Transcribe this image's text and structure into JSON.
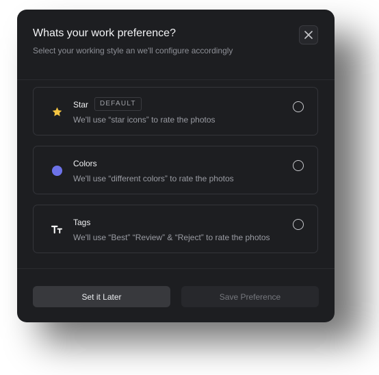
{
  "dialog": {
    "title": "Whats your work preference?",
    "subtitle": "Select your working style an we'll configure accordingly"
  },
  "options": [
    {
      "title": "Star",
      "badge": "DEFAULT",
      "description": "We'll use “star icons” to rate the photos",
      "icon": "star-icon",
      "icon_color": "#f5c542",
      "selected": false
    },
    {
      "title": "Colors",
      "description": "We'll use “different colors” to rate the photos",
      "icon": "color-dot-icon",
      "icon_color": "#6c72e8",
      "selected": false
    },
    {
      "title": "Tags",
      "description": "We'll use “Best” “Review” & “Reject” to rate the photos",
      "icon": "text-tag-icon",
      "icon_color": "#ffffff",
      "selected": false
    }
  ],
  "footer": {
    "secondary_label": "Set it Later",
    "primary_label": "Save Preference"
  },
  "colors": {
    "dialog_bg": "#1d1e21",
    "border": "#34353a",
    "star": "#f5c542",
    "colors_dot": "#6c72e8"
  }
}
